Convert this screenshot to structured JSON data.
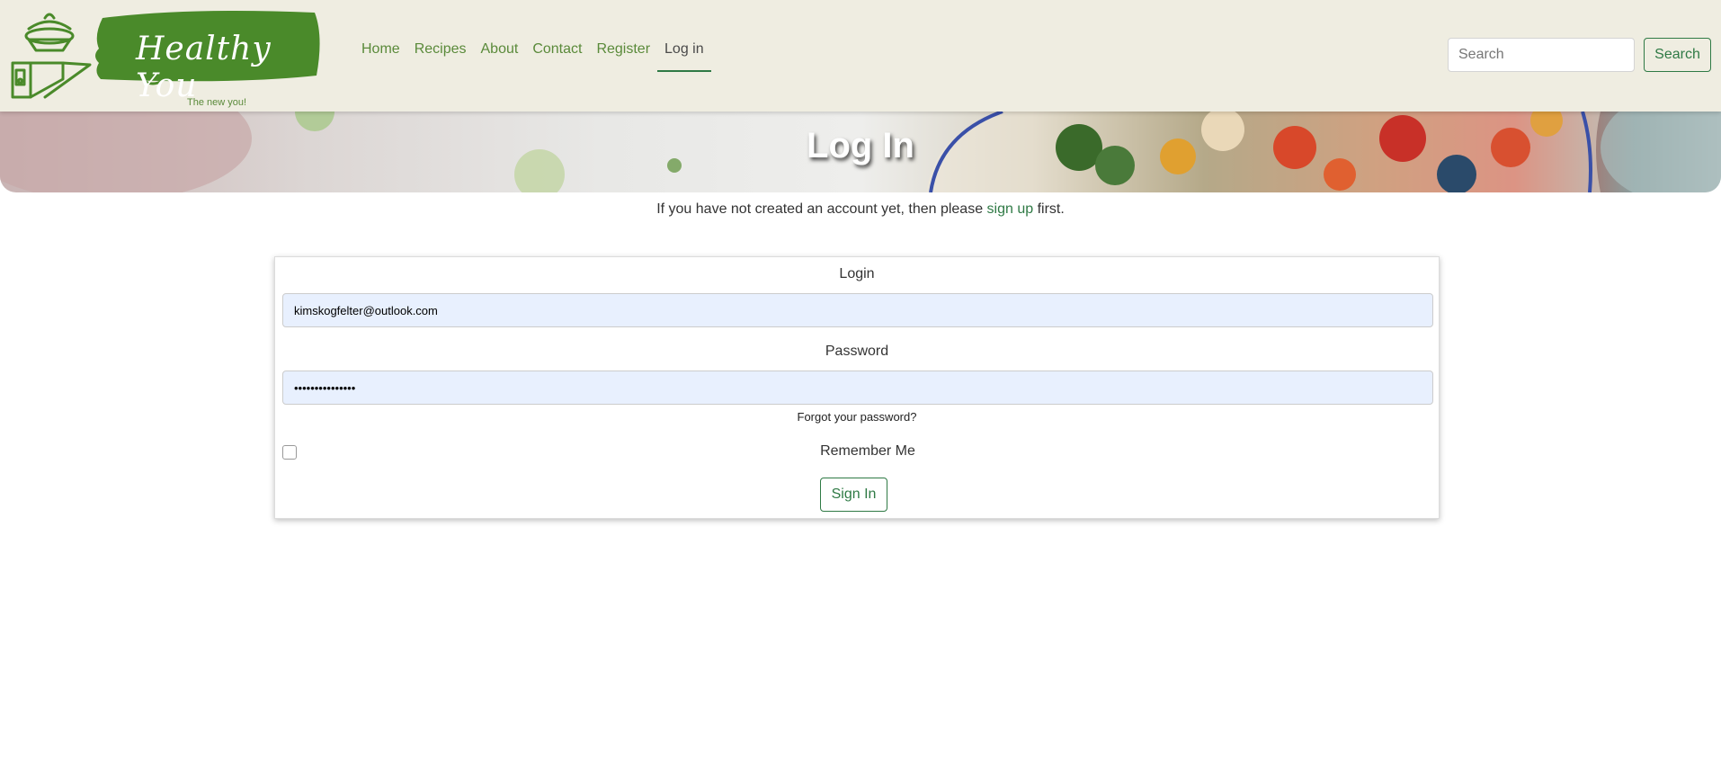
{
  "brand": {
    "name": "Healthy You",
    "tagline": "The new you!",
    "accent_color": "#4a8a2a",
    "brand_green": "#2f7a45",
    "icon": "healthy-bowl-logo-icon"
  },
  "nav": {
    "items": [
      {
        "label": "Home"
      },
      {
        "label": "Recipes"
      },
      {
        "label": "About"
      },
      {
        "label": "Contact"
      },
      {
        "label": "Register"
      },
      {
        "label": "Log in",
        "active": true
      }
    ]
  },
  "search": {
    "placeholder": "Search",
    "button_label": "Search"
  },
  "hero": {
    "title": "Log In"
  },
  "intro": {
    "before": "If you have not created an account yet, then please ",
    "link": "sign up",
    "after": " first."
  },
  "form": {
    "login_label": "Login",
    "login_value": "kimskogfelter@outlook.com",
    "password_label": "Password",
    "password_value": "•••••••••••••••",
    "forgot_link": "Forgot your password?",
    "remember_label": "Remember Me",
    "remember_checked": false,
    "submit_label": "Sign In"
  }
}
